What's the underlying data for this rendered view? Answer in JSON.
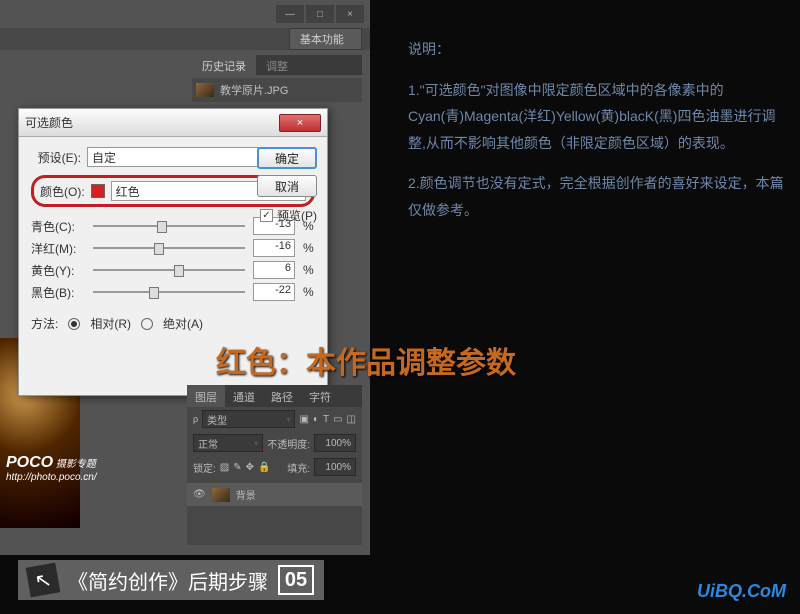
{
  "window": {
    "workspace": "基本功能",
    "minimize": "—",
    "maximize": "□",
    "close": "×"
  },
  "panels": {
    "history": "历史记录",
    "adjustments": "调整",
    "filename": "教学原片.JPG"
  },
  "dialog": {
    "title": "可选颜色",
    "close": "×",
    "preset_label": "预设(E):",
    "preset_value": "自定",
    "color_label": "颜色(O):",
    "color_value": "红色",
    "ok": "确定",
    "cancel": "取消",
    "preview": "预览(P)",
    "preview_checked": "✓",
    "sliders": {
      "cyan": {
        "label": "青色(C):",
        "value": "-13"
      },
      "magenta": {
        "label": "洋红(M):",
        "value": "-16"
      },
      "yellow": {
        "label": "黄色(Y):",
        "value": "6"
      },
      "black": {
        "label": "黑色(B):",
        "value": "-22"
      }
    },
    "percent": "%",
    "method_label": "方法:",
    "relative": "相对(R)",
    "absolute": "绝对(A)"
  },
  "layers": {
    "tab_layers": "图层",
    "tab_channels": "通道",
    "tab_paths": "路径",
    "tab_chars": "字符",
    "kind": "类型",
    "blend": "正常",
    "opacity_label": "不透明度:",
    "opacity": "100%",
    "lock_label": "锁定:",
    "fill_label": "填充:",
    "fill": "100%",
    "layer_name": "背景"
  },
  "text": {
    "desc_title": "说明：",
    "desc_1": "1.\"可选颜色\"对图像中限定颜色区域中的各像素中的Cyan(青)Magenta(洋红)Yellow(黄)blacK(黑)四色油墨进行调整,从而不影响其他颜色（非限定颜色区域）的表现。",
    "desc_2": "2.颜色调节也没有定式，完全根据创作者的喜好来设定，本篇仅做参考。",
    "heading": "红色：本作品调整参数"
  },
  "poco": {
    "brand": "POCO",
    "sub": "摄影专题",
    "url": "http://photo.poco.cn/"
  },
  "footer": {
    "title": "《简约创作》后期步骤",
    "step": "05"
  },
  "uibq": "UiBQ.CoM"
}
